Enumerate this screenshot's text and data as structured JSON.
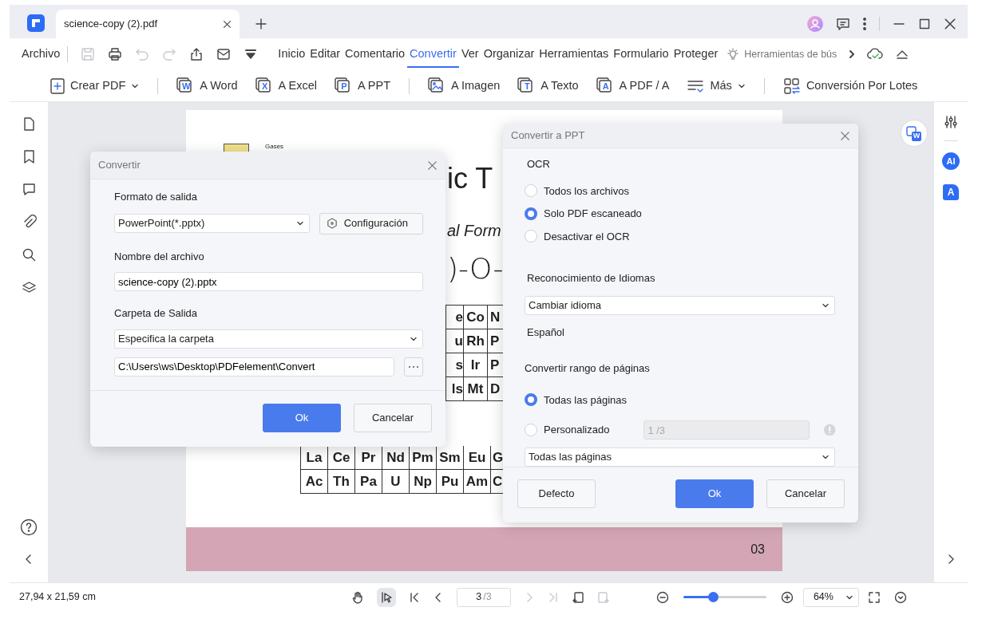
{
  "tab": {
    "title": "science-copy (2).pdf"
  },
  "menu": {
    "file": "Archivo",
    "quick_tools": [
      {
        "kind": "save",
        "disabled": true
      },
      {
        "kind": "print",
        "disabled": false
      },
      {
        "kind": "undo",
        "disabled": true
      },
      {
        "kind": "redo",
        "disabled": true
      },
      {
        "kind": "share",
        "disabled": false
      },
      {
        "kind": "mail",
        "disabled": false
      },
      {
        "kind": "customize",
        "disabled": false
      }
    ],
    "items": [
      {
        "label": "Inicio",
        "selected": false
      },
      {
        "label": "Editar",
        "selected": false
      },
      {
        "label": "Comentario",
        "selected": false
      },
      {
        "label": "Convertir",
        "selected": true
      },
      {
        "label": "Ver",
        "selected": false
      },
      {
        "label": "Organizar",
        "selected": false
      },
      {
        "label": "Herramientas",
        "selected": false
      },
      {
        "label": "Formulario",
        "selected": false
      },
      {
        "label": "Proteger",
        "selected": false
      }
    ],
    "search": {
      "placeholder": "Herramientas de bús"
    }
  },
  "toolbar": [
    {
      "kind": "plus",
      "label": "Crear PDF",
      "dropdown": true,
      "divider_before": false
    },
    {
      "kind": "letter",
      "glyph": "W",
      "label": "A Word",
      "dropdown": false,
      "divider_before": true
    },
    {
      "kind": "letter",
      "glyph": "X",
      "label": "A Excel",
      "dropdown": false,
      "divider_before": false
    },
    {
      "kind": "letter",
      "glyph": "P",
      "label": "A PPT",
      "dropdown": false,
      "divider_before": false
    },
    {
      "kind": "image",
      "label": "A Imagen",
      "dropdown": false,
      "divider_before": true
    },
    {
      "kind": "letter",
      "glyph": "T",
      "label": "A Texto",
      "dropdown": false,
      "divider_before": false
    },
    {
      "kind": "letter",
      "glyph": "A",
      "label": "A PDF / A",
      "dropdown": false,
      "divider_before": false
    },
    {
      "kind": "more",
      "label": "Más",
      "dropdown": true,
      "divider_before": false
    },
    {
      "kind": "batch",
      "label": "Conversión Por Lotes",
      "dropdown": false,
      "divider_before": true
    }
  ],
  "document": {
    "legend": "Gases",
    "title_fragment": "ic T",
    "subtitle_fragment": "al Form",
    "formula_fragment": ")-O-",
    "upper_cells": [
      [
        "e",
        "Co",
        "N"
      ],
      [
        "u",
        "Rh",
        "P"
      ],
      [
        "s",
        "Ir",
        "P"
      ],
      [
        "ls",
        "Mt",
        "D"
      ]
    ],
    "lower_cells": [
      [
        "La",
        "Ce",
        "Pr",
        "Nd",
        "Pm",
        "Sm",
        "Eu",
        "G"
      ],
      [
        "Ac",
        "Th",
        "Pa",
        "U",
        "Np",
        "Pu",
        "Am",
        "C"
      ]
    ],
    "page_number": "03"
  },
  "floating_badge": "W",
  "right_sidebar": {
    "ai_label": "AI",
    "translate_glyph": "A"
  },
  "convert_dialog": {
    "title": "Convertir",
    "format_label": "Formato de salida",
    "format_value": "PowerPoint(*.pptx)",
    "settings_button": "Configuración",
    "name_label": "Nombre del archivo",
    "name_value": "science-copy (2).pptx",
    "folder_label": "Carpeta de Salida",
    "folder_choice": "Especifica la carpeta",
    "folder_path": "C:\\Users\\ws\\Desktop\\PDFelement\\Convert",
    "buttons": [
      {
        "label": "Ok",
        "kind": "confirm"
      },
      {
        "label": "Cancelar",
        "kind": "cancel"
      }
    ]
  },
  "ppt_dialog": {
    "title": "Convertir a PPT",
    "ocr_label": "OCR",
    "ocr_options": [
      {
        "label": "Todos los archivos",
        "selected": false
      },
      {
        "label": "Solo PDF escaneado",
        "selected": true
      },
      {
        "label": "Desactivar el OCR",
        "selected": false
      }
    ],
    "language_label": "Reconocimiento de Idiomas",
    "language_select": "Cambiar idioma",
    "language_value": "Español",
    "range_label": "Convertir rango de páginas",
    "range_options": [
      {
        "label": "Todas las páginas",
        "selected": true,
        "kind": "plain"
      },
      {
        "label": "Personalizado",
        "selected": false,
        "kind": "custom",
        "field_value": "1 /3",
        "disabled": true
      }
    ],
    "range_select": "Todas las páginas",
    "buttons": [
      {
        "label": "Defecto",
        "kind": "reset"
      },
      {
        "label": "Ok",
        "kind": "confirm"
      },
      {
        "label": "Cancelar",
        "kind": "cancel"
      }
    ]
  },
  "status_bar": {
    "size": "27,94 x 21,59 cm",
    "page": "3",
    "page_total": "/3",
    "zoom": "64%",
    "zoom_slider": {
      "level": 0.36
    },
    "nav": [
      {
        "kind": "first",
        "disabled": false
      },
      {
        "kind": "prev",
        "disabled": false
      },
      {
        "kind": "next",
        "disabled": true
      },
      {
        "kind": "last",
        "disabled": true
      }
    ]
  }
}
